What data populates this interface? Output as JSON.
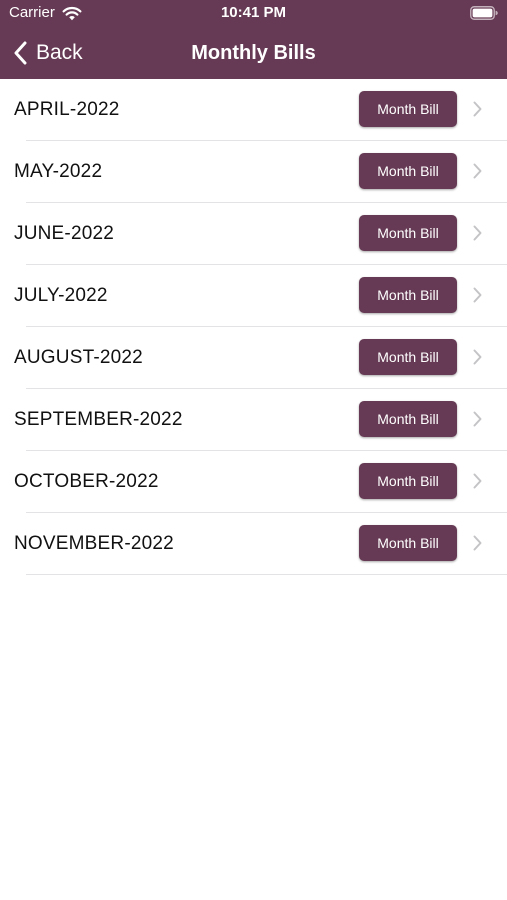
{
  "status_bar": {
    "carrier": "Carrier",
    "time": "10:41 PM",
    "wifi_icon": "wifi-icon",
    "battery_icon": "battery-icon"
  },
  "nav": {
    "back_label": "Back",
    "back_icon": "chevron-left-icon",
    "title": "Monthly Bills"
  },
  "colors": {
    "brand": "#663a54",
    "separator": "#e3e3e6",
    "chevron": "#c4c4c7"
  },
  "bills": [
    {
      "month": "APRIL-2022",
      "button_label": "Month Bill"
    },
    {
      "month": "MAY-2022",
      "button_label": "Month Bill"
    },
    {
      "month": "JUNE-2022",
      "button_label": "Month Bill"
    },
    {
      "month": "JULY-2022",
      "button_label": "Month Bill"
    },
    {
      "month": "AUGUST-2022",
      "button_label": "Month Bill"
    },
    {
      "month": "SEPTEMBER-2022",
      "button_label": "Month Bill"
    },
    {
      "month": "OCTOBER-2022",
      "button_label": "Month Bill"
    },
    {
      "month": "NOVEMBER-2022",
      "button_label": "Month Bill"
    }
  ]
}
